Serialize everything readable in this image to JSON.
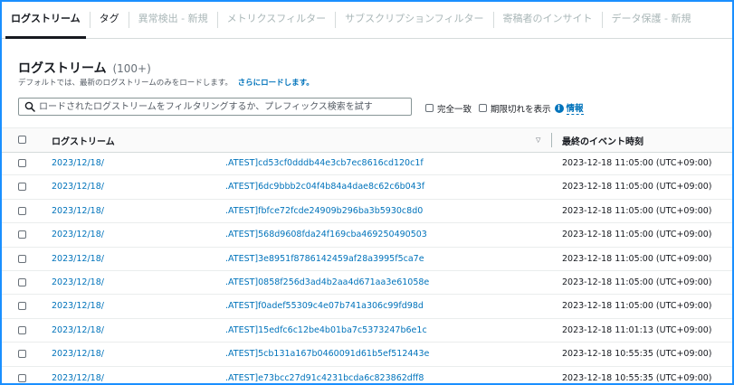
{
  "tabs": [
    {
      "label": "ログストリーム",
      "state": "active"
    },
    {
      "label": "タグ",
      "state": "normal"
    },
    {
      "label": "異常検出 - 新規",
      "state": "disabled"
    },
    {
      "label": "メトリクスフィルター",
      "state": "disabled"
    },
    {
      "label": "サブスクリプションフィルター",
      "state": "disabled"
    },
    {
      "label": "寄稿者のインサイト",
      "state": "disabled"
    },
    {
      "label": "データ保護 - 新規",
      "state": "disabled"
    }
  ],
  "section": {
    "title": "ログストリーム",
    "count": "(100+)",
    "description": "デフォルトでは、最新のログストリームのみをロードします。",
    "load_more": "さらにロードします。"
  },
  "search": {
    "placeholder": "ロードされたログストリームをフィルタリングするか、プレフィックス検索を試す",
    "value": ""
  },
  "options": {
    "exact_match": "完全一致",
    "show_expired": "期限切れを表示",
    "info": "情報"
  },
  "table": {
    "col_stream": "ログストリーム",
    "col_time": "最終のイベント時刻",
    "rows": [
      {
        "date": "2023/12/18/",
        "stream_id": ".ATEST]cd53cf0dddb44e3cb7ec8616cd120c1f",
        "time": "2023-12-18 11:05:00 (UTC+09:00)"
      },
      {
        "date": "2023/12/18/",
        "stream_id": ".ATEST]6dc9bbb2c04f4b84a4dae8c62c6b043f",
        "time": "2023-12-18 11:05:00 (UTC+09:00)"
      },
      {
        "date": "2023/12/18/",
        "stream_id": ".ATEST]fbfce72fcde24909b296ba3b5930c8d0",
        "time": "2023-12-18 11:05:00 (UTC+09:00)"
      },
      {
        "date": "2023/12/18/",
        "stream_id": ".ATEST]568d9608fda24f169cba469250490503",
        "time": "2023-12-18 11:05:00 (UTC+09:00)"
      },
      {
        "date": "2023/12/18/",
        "stream_id": ".ATEST]3e8951f8786142459af28a3995f5ca7e",
        "time": "2023-12-18 11:05:00 (UTC+09:00)"
      },
      {
        "date": "2023/12/18/",
        "stream_id": ".ATEST]0858f256d3ad4b2aa4d671aa3e61058e",
        "time": "2023-12-18 11:05:00 (UTC+09:00)"
      },
      {
        "date": "2023/12/18/",
        "stream_id": ".ATEST]f0adef55309c4e07b741a306c99fd98d",
        "time": "2023-12-18 11:05:00 (UTC+09:00)"
      },
      {
        "date": "2023/12/18/",
        "stream_id": ".ATEST]15edfc6c12be4b01ba7c5373247b6e1c",
        "time": "2023-12-18 11:01:13 (UTC+09:00)"
      },
      {
        "date": "2023/12/18/",
        "stream_id": ".ATEST]5cb131a167b0460091d61b5ef512443e",
        "time": "2023-12-18 10:55:35 (UTC+09:00)"
      },
      {
        "date": "2023/12/18/",
        "stream_id": ".ATEST]e73bcc27d91c4231bcda6c823862dff8",
        "time": "2023-12-18 10:55:35 (UTC+09:00)"
      }
    ]
  },
  "colors": {
    "link": "#0073bb",
    "frame_border": "#1a8fff",
    "text": "#16191f",
    "disabled_tab": "#aab7b8"
  }
}
